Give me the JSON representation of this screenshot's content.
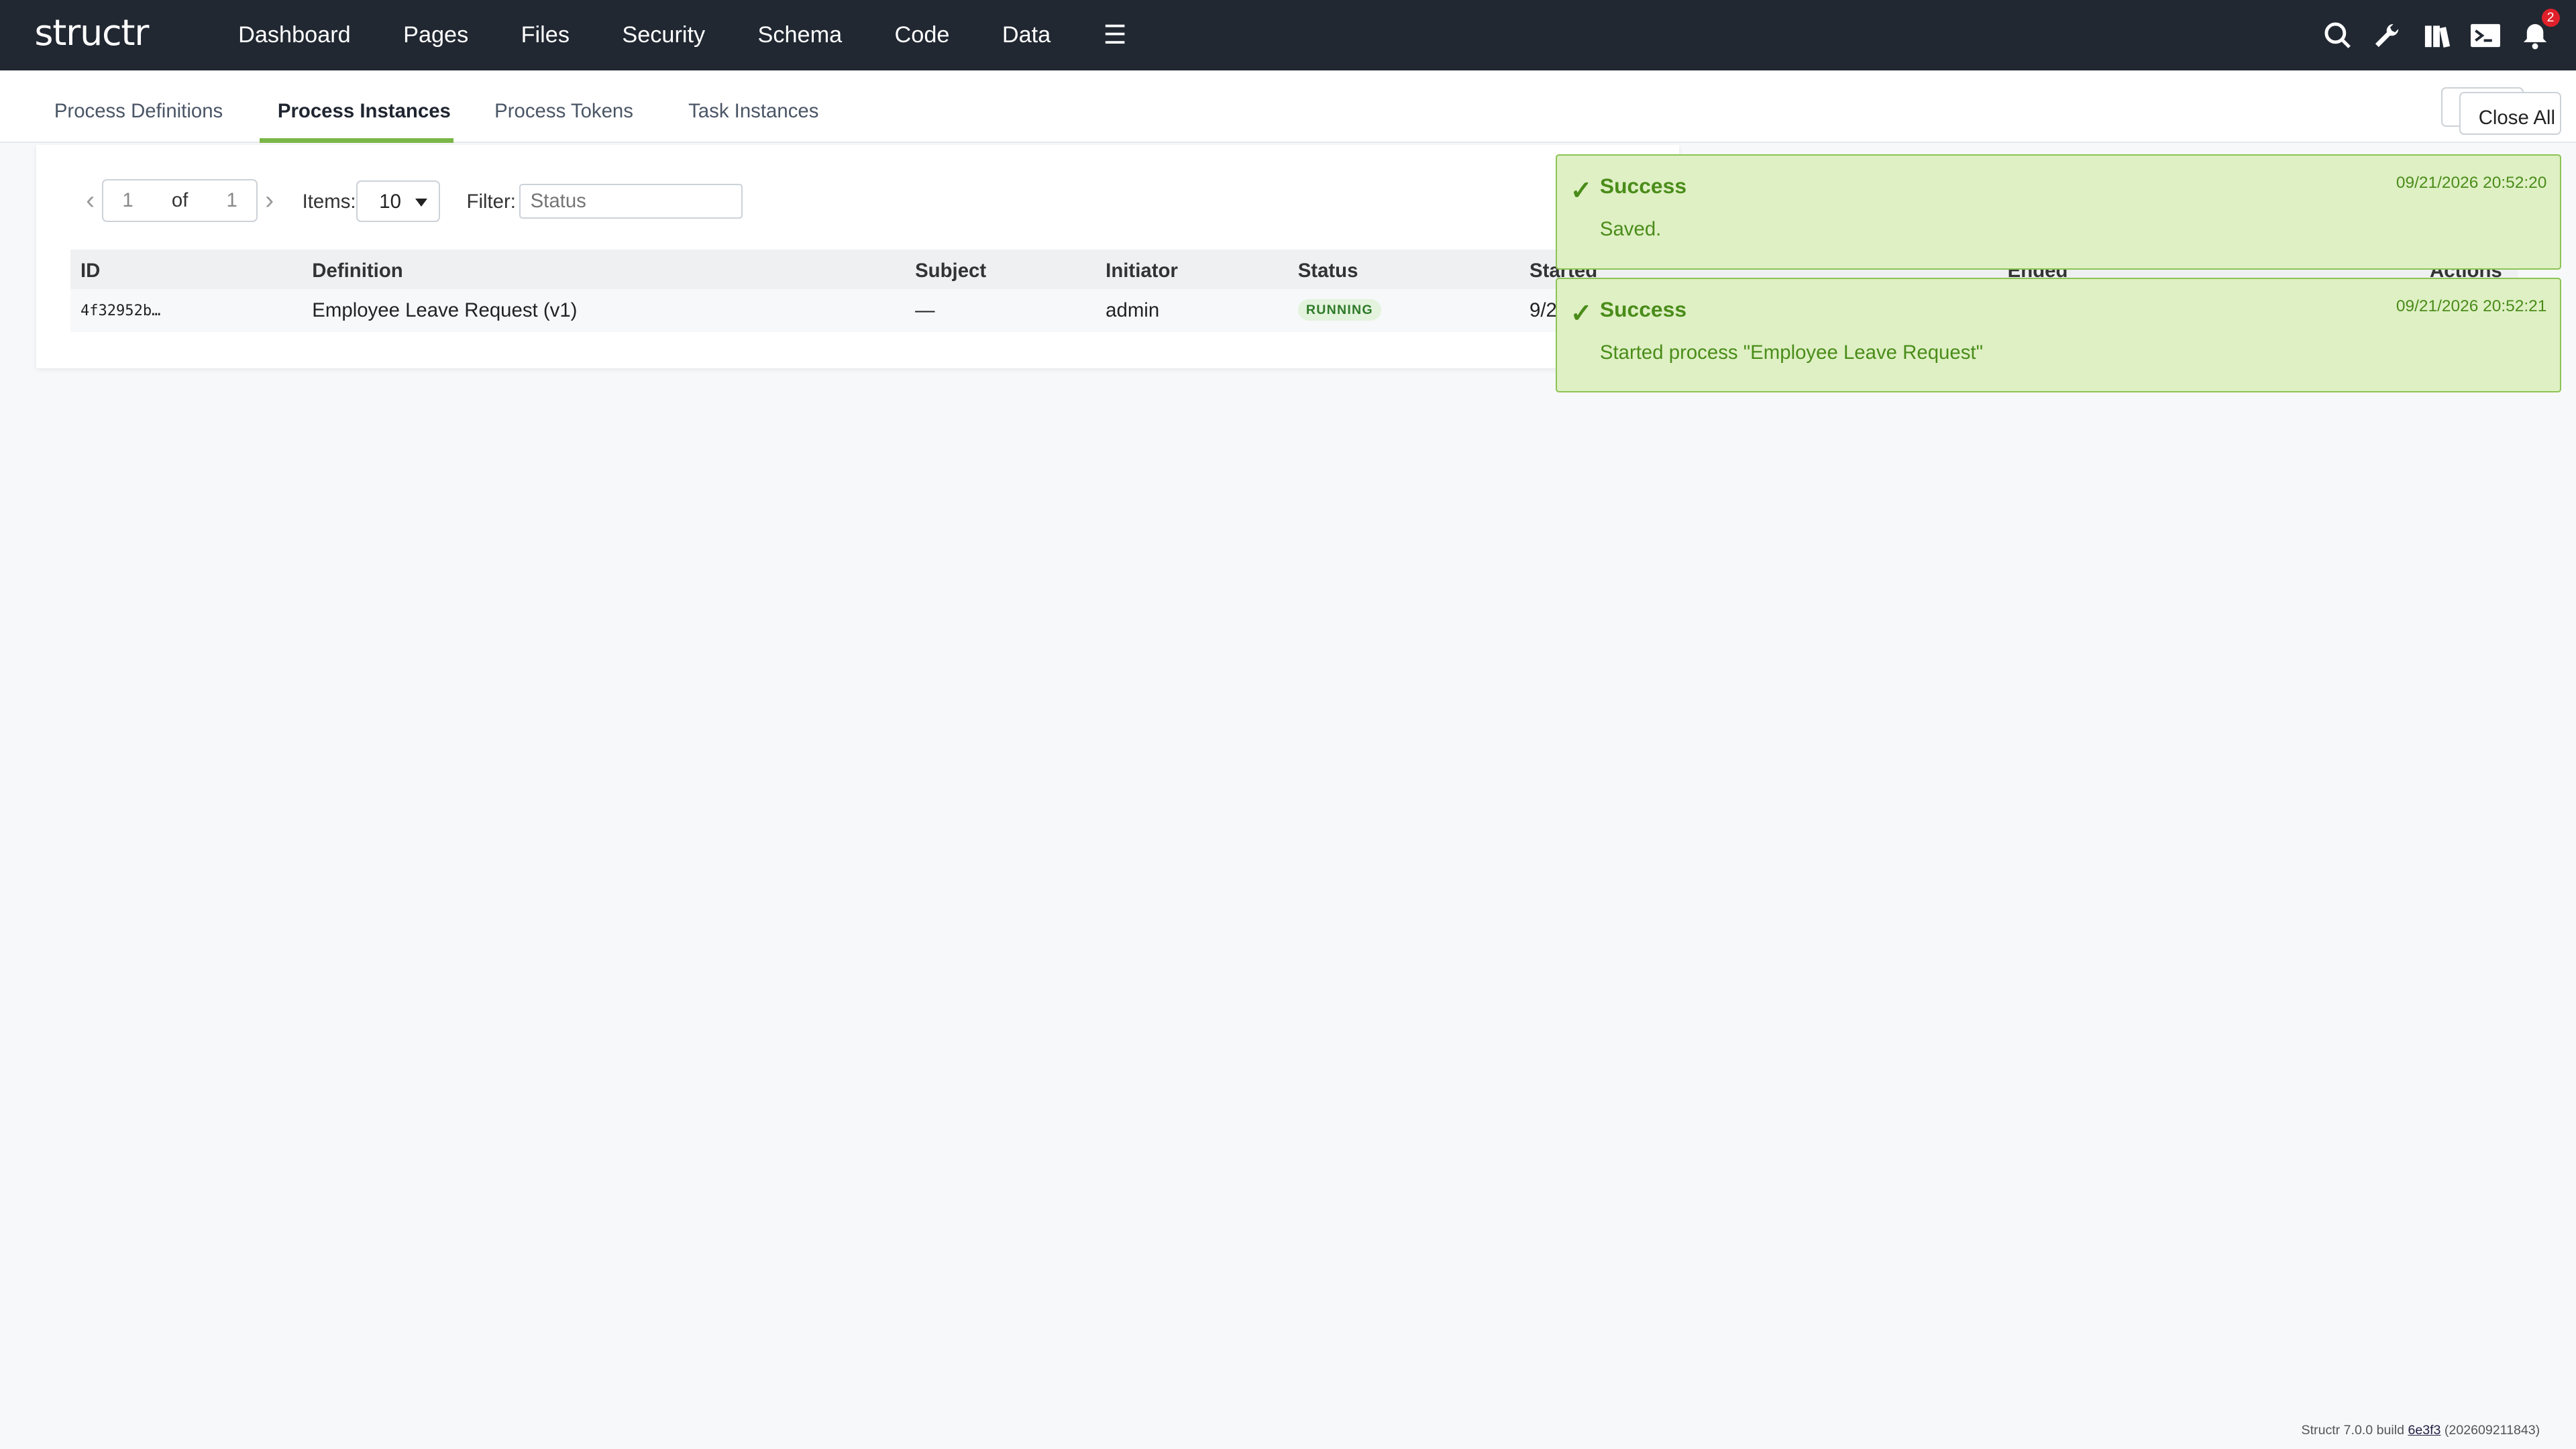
{
  "app": {
    "logo": "structr"
  },
  "nav": {
    "items": [
      {
        "label": "Dashboard"
      },
      {
        "label": "Pages"
      },
      {
        "label": "Files"
      },
      {
        "label": "Security"
      },
      {
        "label": "Schema"
      },
      {
        "label": "Code"
      },
      {
        "label": "Data"
      }
    ],
    "menu_icon": "hamburger-icon",
    "notification_count": "2",
    "icons": [
      "search-icon",
      "wrench-icon",
      "docs-icon",
      "terminal-icon",
      "bell-icon"
    ]
  },
  "subtabs": {
    "items": [
      {
        "label": "Process Definitions"
      },
      {
        "label": "Process Instances",
        "active": true
      },
      {
        "label": "Process Tokens"
      },
      {
        "label": "Task Instances"
      }
    ]
  },
  "pager": {
    "page": "1",
    "of_label": "of",
    "total": "1",
    "items_label": "Items:",
    "items_value": "10",
    "filter_label": "Filter:",
    "filter_placeholder": "Status"
  },
  "table": {
    "columns": [
      "ID",
      "Definition",
      "Subject",
      "Initiator",
      "Status",
      "Started",
      "Ended",
      "Actions"
    ],
    "rows": [
      {
        "id": "4f32952b…",
        "definition": "Employee Leave Request (v1)",
        "subject": "—",
        "initiator": "admin",
        "status": "RUNNING",
        "started": "9/2"
      }
    ]
  },
  "toasts": [
    {
      "title": "Success",
      "time": "09/21/2026 20:52:20",
      "message": "Saved."
    },
    {
      "title": "Success",
      "time": "09/21/2026 20:52:21",
      "message": "Started process \"Employee Leave Request\""
    }
  ],
  "close_all": {
    "label": "Close All"
  },
  "footer": {
    "prefix": "Structr 7.0.0 build",
    "build": "6e3f3",
    "suffix": "(202609211843)"
  },
  "colors": {
    "topbar": "#212832",
    "accent": "#7ab648",
    "toast_bg": "#dff0c4",
    "toast_text": "#4a8c1a"
  }
}
